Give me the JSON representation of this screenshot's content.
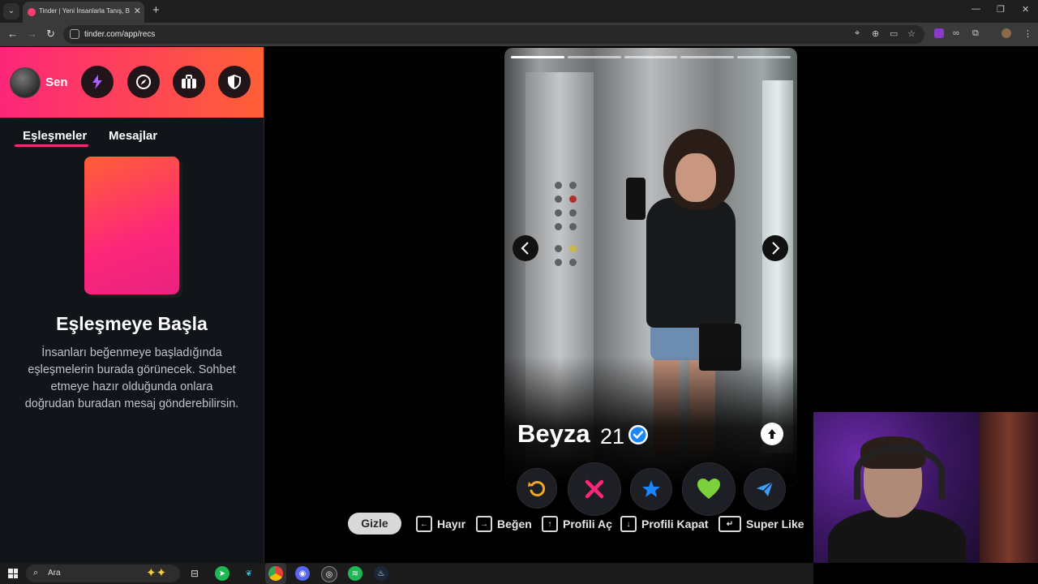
{
  "browser": {
    "tab_title": "Tinder | Yeni İnsanlarla Tanış, Bu",
    "url": "tinder.com/app/recs"
  },
  "sidebar": {
    "user_name": "Sen",
    "tabs": [
      {
        "label": "Eşleşmeler",
        "active": true
      },
      {
        "label": "Mesajlar",
        "active": false
      }
    ],
    "empty_title": "Eşleşmeye Başla",
    "empty_description": "İnsanları beğenmeye başladığında eşleşmelerin burada görünecek. Sohbet etmeye hazır olduğunda onlara doğrudan buradan mesaj gönderebilirsin.",
    "header_buttons": [
      "lightning-icon",
      "explore-icon",
      "briefcase-icon",
      "shield-icon"
    ]
  },
  "profile": {
    "name": "Beyza",
    "age": "21",
    "verified": true,
    "photo_count": 5,
    "active_photo": 1
  },
  "actions": [
    "rewind",
    "nope",
    "super-like",
    "like",
    "boost"
  ],
  "shortcuts": {
    "hide_label": "Gizle",
    "items": [
      {
        "key": "←",
        "label": "Hayır"
      },
      {
        "key": "→",
        "label": "Beğen"
      },
      {
        "key": "↑",
        "label": "Profili Aç"
      },
      {
        "key": "↓",
        "label": "Profili Kapat"
      },
      {
        "key": "↵",
        "label": "Super Like"
      }
    ]
  },
  "taskbar": {
    "search_placeholder": "Ara"
  },
  "colors": {
    "brand_start": "#fd267a",
    "brand_end": "#ff6036",
    "rewind": "#f5a623",
    "nope": "#fd267a",
    "super_like": "#1786ff",
    "like": "#7bd13b",
    "boost": "#3aa0ff"
  }
}
